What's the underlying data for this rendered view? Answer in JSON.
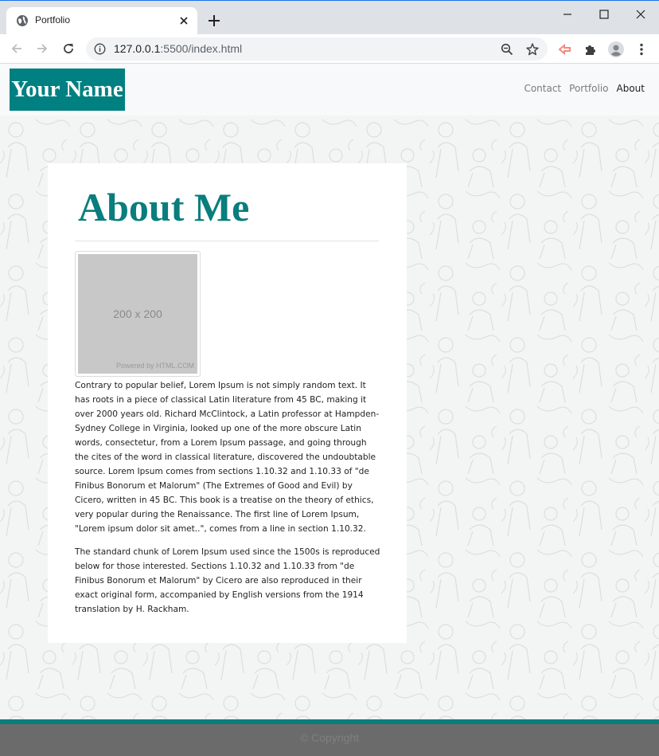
{
  "browser": {
    "tab_title": "Portfolio",
    "url_host": "127.0.0.1",
    "url_rest": ":5500/index.html"
  },
  "page": {
    "brand": "Your Name",
    "nav": [
      {
        "label": "Contact",
        "active": false
      },
      {
        "label": "Portfolio",
        "active": false
      },
      {
        "label": "About",
        "active": true
      }
    ],
    "heading": "About Me",
    "placeholder_size": "200 x 200",
    "placeholder_credit": "Powered by HTML.COM",
    "paragraphs": [
      "Contrary to popular belief, Lorem Ipsum is not simply random text. It has roots in a piece of classical Latin literature from 45 BC, making it over 2000 years old. Richard McClintock, a Latin professor at Hampden-Sydney College in Virginia, looked up one of the more obscure Latin words, consectetur, from a Lorem Ipsum passage, and going through the cites of the word in classical literature, discovered the undoubtable source. Lorem Ipsum comes from sections 1.10.32 and 1.10.33 of \"de Finibus Bonorum et Malorum\" (The Extremes of Good and Evil) by Cicero, written in 45 BC. This book is a treatise on the theory of ethics, very popular during the Renaissance. The first line of Lorem Ipsum, \"Lorem ipsum dolor sit amet..\", comes from a line in section 1.10.32.",
      "The standard chunk of Lorem Ipsum used since the 1500s is reproduced below for those interested. Sections 1.10.32 and 1.10.33 from \"de Finibus Bonorum et Malorum\" by Cicero are also reproduced in their exact original form, accompanied by English versions from the 1914 translation by H. Rackham."
    ],
    "footer": "© Copyright"
  },
  "colors": {
    "brand_bg": "#008080",
    "heading": "#0a7d7d",
    "footer_bg": "#6b6b6b"
  },
  "icons": [
    "globe-icon",
    "close-icon",
    "plus-icon",
    "minimize-icon",
    "maximize-icon",
    "back-arrow-icon",
    "forward-arrow-icon",
    "reload-icon",
    "info-icon",
    "zoom-icon",
    "star-icon",
    "extension-icon",
    "puzzle-icon",
    "profile-icon",
    "kebab-menu-icon"
  ]
}
